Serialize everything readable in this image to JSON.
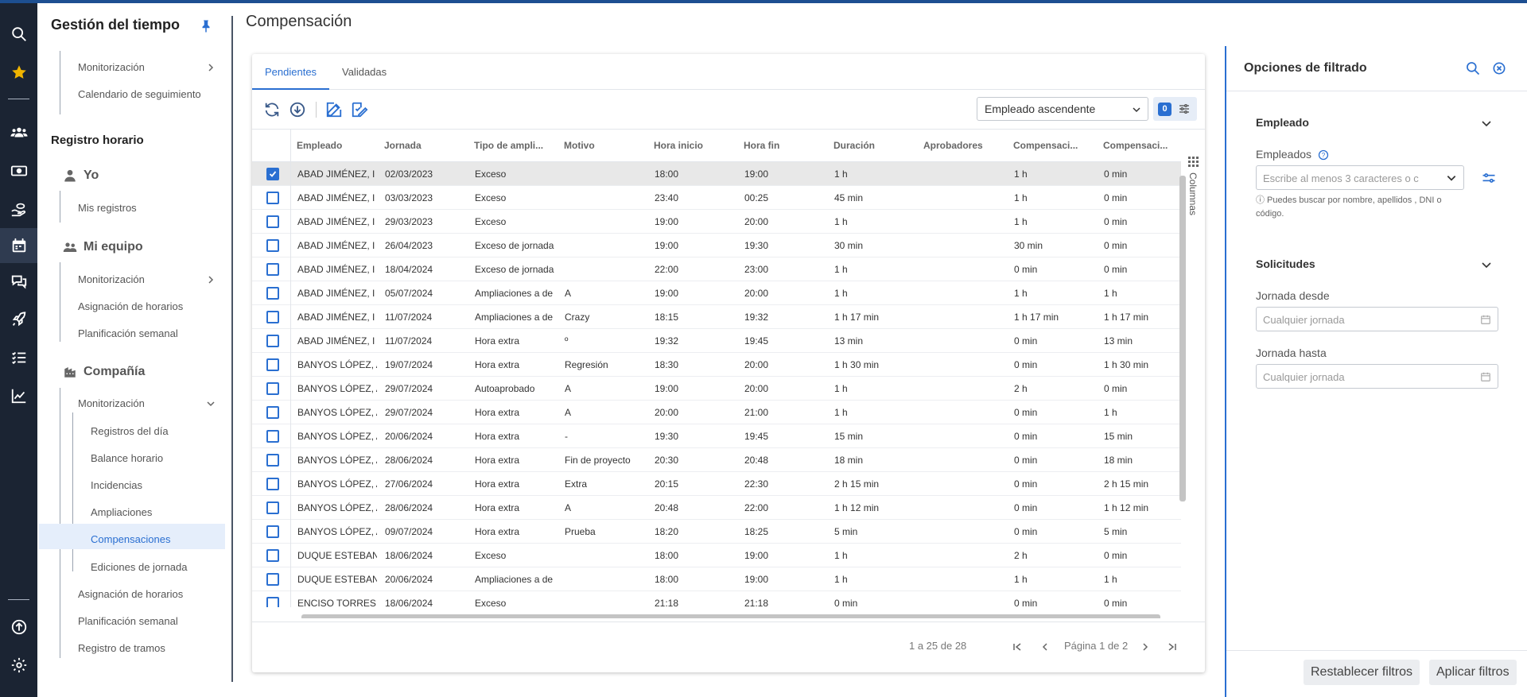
{
  "colors": {
    "accent": "#2a6fd1",
    "rail": "#1b2433",
    "star": "#f0b400"
  },
  "rail_icons": [
    "search-icon",
    "star-icon",
    "users-icon",
    "money-icon",
    "hand-money-icon",
    "calendar-icon",
    "chat-icon",
    "rocket-icon",
    "checklist-icon",
    "chart-icon",
    "upload-icon",
    "gear-icon"
  ],
  "nav": {
    "title": "Gestión del tiempo",
    "top_items": [
      "Monitorización",
      "Calendario de seguimiento"
    ],
    "registro": {
      "title": "Registro horario",
      "yo": {
        "label": "Yo",
        "items": [
          "Mis registros"
        ]
      },
      "mi_equipo": {
        "label": "Mi equipo",
        "items": [
          "Monitorización",
          "Asignación de horarios",
          "Planificación semanal"
        ]
      },
      "compania": {
        "label": "Compañía",
        "monitorizacion": "Monitorización",
        "sub_items": [
          "Registros del día",
          "Balance horario",
          "Incidencias",
          "Ampliaciones",
          "Compensaciones",
          "Ediciones de jornada"
        ],
        "items": [
          "Asignación de horarios",
          "Planificación semanal",
          "Registro de tramos"
        ]
      }
    },
    "active_item": "Compensaciones"
  },
  "page": {
    "title": "Compensación"
  },
  "tabs": [
    {
      "label": "Pendientes",
      "active": true
    },
    {
      "label": "Validadas",
      "active": false
    }
  ],
  "toolbar": {
    "sort_value": "Empleado ascendente",
    "filter_count": "0"
  },
  "grid": {
    "columns": [
      "Empleado",
      "Jornada",
      "Tipo de ampli...",
      "Motivo",
      "Hora inicio",
      "Hora fin",
      "Duración",
      "Aprobadores",
      "Compensaci...",
      "Compensaci..."
    ],
    "columns_label": "Columnas",
    "rows": [
      {
        "checked": true,
        "cells": [
          "ABAD JIMÉNEZ, I",
          "02/03/2023",
          "Exceso",
          "",
          "18:00",
          "19:00",
          "1 h",
          "",
          "1 h",
          "0 min"
        ]
      },
      {
        "checked": false,
        "cells": [
          "ABAD JIMÉNEZ, I",
          "03/03/2023",
          "Exceso",
          "",
          "23:40",
          "00:25",
          "45 min",
          "",
          "1 h",
          "0 min"
        ]
      },
      {
        "checked": false,
        "cells": [
          "ABAD JIMÉNEZ, I",
          "29/03/2023",
          "Exceso",
          "",
          "19:00",
          "20:00",
          "1 h",
          "",
          "1 h",
          "0 min"
        ]
      },
      {
        "checked": false,
        "cells": [
          "ABAD JIMÉNEZ, I",
          "26/04/2023",
          "Exceso de jornada",
          "",
          "19:00",
          "19:30",
          "30 min",
          "",
          "30 min",
          "0 min"
        ]
      },
      {
        "checked": false,
        "cells": [
          "ABAD JIMÉNEZ, I",
          "18/04/2024",
          "Exceso de jornada",
          "",
          "22:00",
          "23:00",
          "1 h",
          "",
          "0 min",
          "0 min"
        ]
      },
      {
        "checked": false,
        "cells": [
          "ABAD JIMÉNEZ, I",
          "05/07/2024",
          "Ampliaciones a de",
          "A",
          "19:00",
          "20:00",
          "1 h",
          "",
          "1 h",
          "1 h"
        ]
      },
      {
        "checked": false,
        "cells": [
          "ABAD JIMÉNEZ, I",
          "11/07/2024",
          "Ampliaciones a de",
          "Crazy",
          "18:15",
          "19:32",
          "1 h 17 min",
          "",
          "1 h 17 min",
          "1 h 17 min"
        ]
      },
      {
        "checked": false,
        "cells": [
          "ABAD JIMÉNEZ, I",
          "11/07/2024",
          "Hora extra",
          "º",
          "19:32",
          "19:45",
          "13 min",
          "",
          "0 min",
          "13 min"
        ]
      },
      {
        "checked": false,
        "cells": [
          "BANYOS LÓPEZ, A",
          "19/07/2024",
          "Hora extra",
          "Regresión",
          "18:30",
          "20:00",
          "1 h 30 min",
          "",
          "0 min",
          "1 h 30 min"
        ]
      },
      {
        "checked": false,
        "cells": [
          "BANYOS LÓPEZ, A",
          "29/07/2024",
          "Autoaprobado",
          "A",
          "19:00",
          "20:00",
          "1 h",
          "",
          "2 h",
          "0 min"
        ]
      },
      {
        "checked": false,
        "cells": [
          "BANYOS LÓPEZ, A",
          "29/07/2024",
          "Hora extra",
          "A",
          "20:00",
          "21:00",
          "1 h",
          "",
          "0 min",
          "1 h"
        ]
      },
      {
        "checked": false,
        "cells": [
          "BANYOS LÓPEZ, A",
          "20/06/2024",
          "Hora extra",
          "-",
          "19:30",
          "19:45",
          "15 min",
          "",
          "0 min",
          "15 min"
        ]
      },
      {
        "checked": false,
        "cells": [
          "BANYOS LÓPEZ, A",
          "28/06/2024",
          "Hora extra",
          "Fin de proyecto",
          "20:30",
          "20:48",
          "18 min",
          "",
          "0 min",
          "18 min"
        ]
      },
      {
        "checked": false,
        "cells": [
          "BANYOS LÓPEZ, A",
          "27/06/2024",
          "Hora extra",
          "Extra",
          "20:15",
          "22:30",
          "2 h 15 min",
          "",
          "0 min",
          "2 h 15 min"
        ]
      },
      {
        "checked": false,
        "cells": [
          "BANYOS LÓPEZ, A",
          "28/06/2024",
          "Hora extra",
          "A",
          "20:48",
          "22:00",
          "1 h 12 min",
          "",
          "0 min",
          "1 h 12 min"
        ]
      },
      {
        "checked": false,
        "cells": [
          "BANYOS LÓPEZ, A",
          "09/07/2024",
          "Hora extra",
          "Prueba",
          "18:20",
          "18:25",
          "5 min",
          "",
          "0 min",
          "5 min"
        ]
      },
      {
        "checked": false,
        "cells": [
          "DUQUE ESTEBAN",
          "18/06/2024",
          "Exceso",
          "",
          "18:00",
          "19:00",
          "1 h",
          "",
          "2 h",
          "0 min"
        ]
      },
      {
        "checked": false,
        "cells": [
          "DUQUE ESTEBAN",
          "20/06/2024",
          "Ampliaciones a de",
          "",
          "18:00",
          "19:00",
          "1 h",
          "",
          "1 h",
          "1 h"
        ]
      },
      {
        "checked": false,
        "cells": [
          "ENCISO TORRES,",
          "18/06/2024",
          "Exceso",
          "",
          "21:18",
          "21:18",
          "0 min",
          "",
          "0 min",
          "0 min"
        ]
      }
    ]
  },
  "pager": {
    "range": "1 a 25 de 28",
    "page": "Página 1 de 2"
  },
  "filter_panel": {
    "title": "Opciones de filtrado",
    "empleado_section": "Empleado",
    "empleados_label": "Empleados",
    "empleados_placeholder": "Escribe al menos 3 caracteres o c",
    "hint": "ⓘ Puedes buscar por nombre, apellidos , DNI o código.",
    "solicitudes_section": "Solicitudes",
    "desde_label": "Jornada desde",
    "desde_placeholder": "Cualquier jornada",
    "hasta_label": "Jornada hasta",
    "hasta_placeholder": "Cualquier jornada",
    "reset_label": "Restablecer filtros",
    "apply_label": "Aplicar filtros"
  }
}
